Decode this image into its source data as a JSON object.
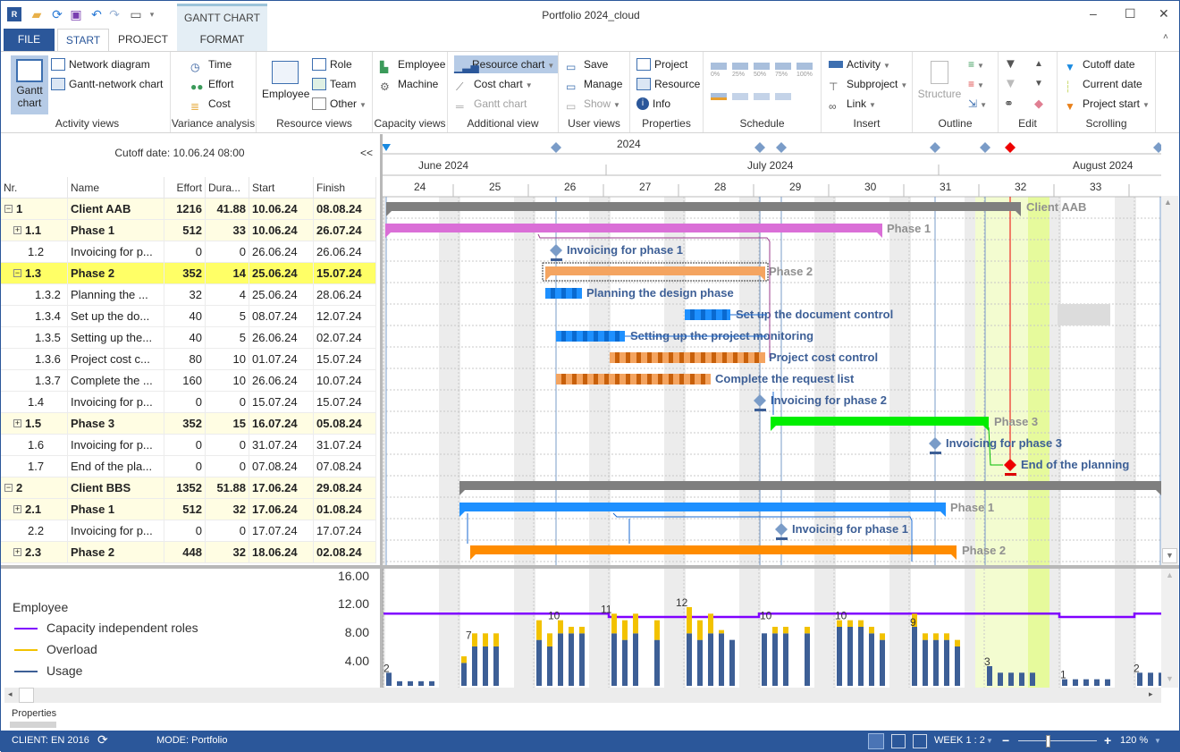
{
  "window": {
    "title": "Portfolio 2024_cloud",
    "contextual_tab_header": "GANTT CHART"
  },
  "tabs": [
    {
      "label": "FILE"
    },
    {
      "label": "START"
    },
    {
      "label": "PROJECT"
    },
    {
      "label": "FORMAT"
    }
  ],
  "ribbon": {
    "activity_views": {
      "label": "Activity views",
      "gantt": "Gantt chart",
      "network": "Network diagram",
      "gantt_network": "Gantt-network chart"
    },
    "variance": {
      "label": "Variance analysis",
      "time": "Time",
      "effort": "Effort",
      "cost": "Cost"
    },
    "resource_views": {
      "label": "Resource views",
      "employee": "Employee",
      "role": "Role",
      "team": "Team",
      "other": "Other"
    },
    "capacity_views": {
      "label": "Capacity views",
      "employee": "Employee",
      "machine": "Machine"
    },
    "additional_view": {
      "label": "Additional view",
      "resource_chart": "Resource chart",
      "cost_chart": "Cost chart",
      "gantt_chart": "Gantt chart"
    },
    "user_views": {
      "label": "User views",
      "save": "Save",
      "manage": "Manage",
      "show": "Show"
    },
    "properties": {
      "label": "Properties",
      "project": "Project",
      "resource": "Resource",
      "info": "Info"
    },
    "schedule": {
      "label": "Schedule",
      "percents": [
        "0%",
        "25%",
        "50%",
        "75%",
        "100%"
      ]
    },
    "insert": {
      "label": "Insert",
      "activity": "Activity",
      "subproject": "Subproject",
      "link": "Link"
    },
    "outline": {
      "label": "Outline",
      "structure": "Structure"
    },
    "edit": {
      "label": "Edit"
    },
    "scrolling": {
      "label": "Scrolling",
      "cutoff": "Cutoff date",
      "current": "Current date",
      "project_start": "Project start"
    }
  },
  "table": {
    "cutoff_label": "Cutoff date: 10.06.24 08:00",
    "collapse": "<<",
    "columns": [
      "Nr.",
      "Name",
      "Effort",
      "Dura...",
      "Start",
      "Finish"
    ],
    "rows": [
      {
        "nr": "1",
        "name": "Client AAB",
        "effort": "1216",
        "dur": "41.88",
        "start": "10.06.24",
        "finish": "08.08.24",
        "style": "sum",
        "expander": "−"
      },
      {
        "nr": "1.1",
        "name": "Phase 1",
        "effort": "512",
        "dur": "33",
        "start": "10.06.24",
        "finish": "26.07.24",
        "style": "sum",
        "expander": "+"
      },
      {
        "nr": "1.2",
        "name": "Invoicing for p...",
        "effort": "0",
        "dur": "0",
        "start": "26.06.24",
        "finish": "26.06.24",
        "style": "",
        "expander": ""
      },
      {
        "nr": "1.3",
        "name": "Phase 2",
        "effort": "352",
        "dur": "14",
        "start": "25.06.24",
        "finish": "15.07.24",
        "style": "hi",
        "expander": "−"
      },
      {
        "nr": "1.3.2",
        "name": "Planning the ...",
        "effort": "32",
        "dur": "4",
        "start": "25.06.24",
        "finish": "28.06.24",
        "style": "",
        "expander": ""
      },
      {
        "nr": "1.3.4",
        "name": "Set up the do...",
        "effort": "40",
        "dur": "5",
        "start": "08.07.24",
        "finish": "12.07.24",
        "style": "",
        "expander": ""
      },
      {
        "nr": "1.3.5",
        "name": "Setting up the...",
        "effort": "40",
        "dur": "5",
        "start": "26.06.24",
        "finish": "02.07.24",
        "style": "",
        "expander": ""
      },
      {
        "nr": "1.3.6",
        "name": "Project cost c...",
        "effort": "80",
        "dur": "10",
        "start": "01.07.24",
        "finish": "15.07.24",
        "style": "",
        "expander": ""
      },
      {
        "nr": "1.3.7",
        "name": "Complete the ...",
        "effort": "160",
        "dur": "10",
        "start": "26.06.24",
        "finish": "10.07.24",
        "style": "",
        "expander": ""
      },
      {
        "nr": "1.4",
        "name": "Invoicing for p...",
        "effort": "0",
        "dur": "0",
        "start": "15.07.24",
        "finish": "15.07.24",
        "style": "",
        "expander": ""
      },
      {
        "nr": "1.5",
        "name": "Phase 3",
        "effort": "352",
        "dur": "15",
        "start": "16.07.24",
        "finish": "05.08.24",
        "style": "sum",
        "expander": "+"
      },
      {
        "nr": "1.6",
        "name": "Invoicing for p...",
        "effort": "0",
        "dur": "0",
        "start": "31.07.24",
        "finish": "31.07.24",
        "style": "",
        "expander": ""
      },
      {
        "nr": "1.7",
        "name": "End of the pla...",
        "effort": "0",
        "dur": "0",
        "start": "07.08.24",
        "finish": "07.08.24",
        "style": "",
        "expander": ""
      },
      {
        "nr": "2",
        "name": "Client BBS",
        "effort": "1352",
        "dur": "51.88",
        "start": "17.06.24",
        "finish": "29.08.24",
        "style": "sum",
        "expander": "−"
      },
      {
        "nr": "2.1",
        "name": "Phase 1",
        "effort": "512",
        "dur": "32",
        "start": "17.06.24",
        "finish": "01.08.24",
        "style": "sum",
        "expander": "+"
      },
      {
        "nr": "2.2",
        "name": "Invoicing for p...",
        "effort": "0",
        "dur": "0",
        "start": "17.07.24",
        "finish": "17.07.24",
        "style": "",
        "expander": ""
      },
      {
        "nr": "2.3",
        "name": "Phase 2",
        "effort": "448",
        "dur": "32",
        "start": "18.06.24",
        "finish": "02.08.24",
        "style": "sum",
        "expander": "+"
      }
    ]
  },
  "timescale": {
    "year": "2024",
    "months": [
      "June 2024",
      "July 2024",
      "August 2024"
    ],
    "weeks": [
      "24",
      "25",
      "26",
      "27",
      "28",
      "29",
      "30",
      "31",
      "32",
      "33"
    ]
  },
  "gantt_labels": {
    "client_aab": "Client AAB",
    "phase1": "Phase 1",
    "inv1": "Invoicing for phase 1",
    "phase2": "Phase 2",
    "planning": "Planning the design phase",
    "docctrl": "Set up the document control",
    "monitoring": "Setting up the project monitoring",
    "costctrl": "Project cost control",
    "request": "Complete the request list",
    "inv2": "Invoicing for phase 2",
    "phase3": "Phase 3",
    "inv3": "Invoicing for phase 3",
    "end": "End of the planning",
    "bbs_phase1": "Phase 1",
    "bbs_inv1": "Invoicing for phase 1",
    "bbs_phase2": "Phase 2"
  },
  "chart_data": {
    "type": "bar",
    "title": "Employee",
    "legend": [
      {
        "name": "Capacity independent roles",
        "color": "#8000ff"
      },
      {
        "name": "Overload",
        "color": "#f2c200"
      },
      {
        "name": "Usage",
        "color": "#3d5f96"
      }
    ],
    "yticks": [
      "16.00",
      "12.00",
      "8.00",
      "4.00"
    ],
    "ylim": [
      0,
      16
    ],
    "week_peaks": [
      {
        "week": "24",
        "value": 2
      },
      {
        "week": "25",
        "value": 7
      },
      {
        "week": "26",
        "value": 10
      },
      {
        "week": "27",
        "value": 11
      },
      {
        "week": "28",
        "value": 12
      },
      {
        "week": "29",
        "value": 10
      },
      {
        "week": "30",
        "value": 10
      },
      {
        "week": "31",
        "value": 9
      },
      {
        "week": "32",
        "value": 3
      },
      {
        "week": "33",
        "value": 1
      },
      {
        "week": "34",
        "value": 2
      }
    ]
  },
  "status": {
    "client": "CLIENT: EN 2016",
    "mode": "MODE: Portfolio",
    "scale": "WEEK 1 : 2",
    "zoom": "120 %"
  },
  "properties_label": "Properties"
}
